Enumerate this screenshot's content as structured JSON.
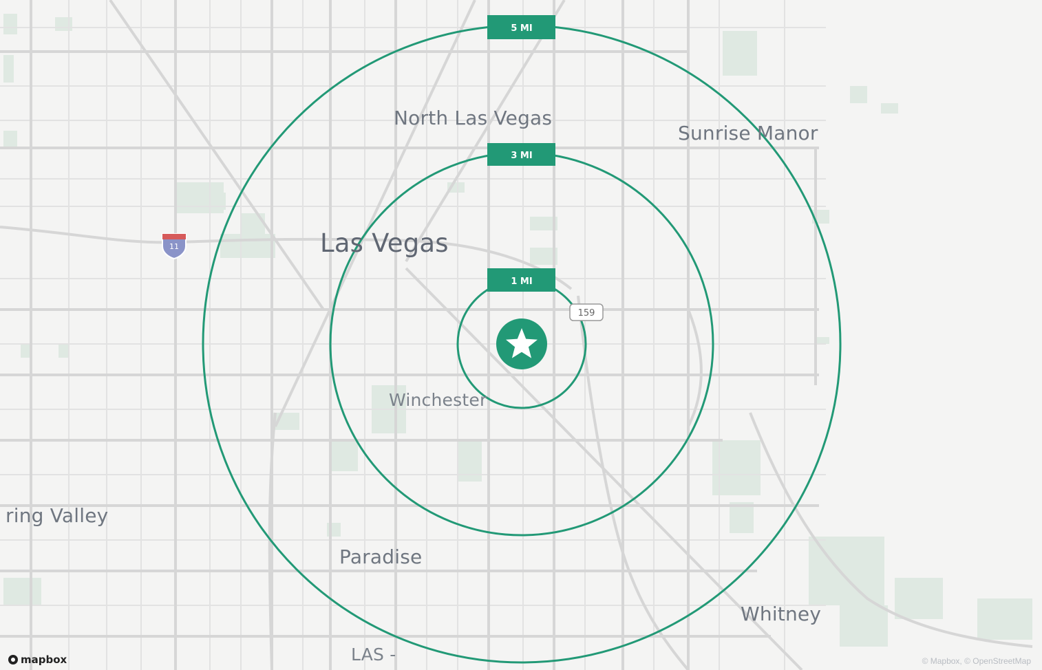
{
  "map": {
    "places": [
      {
        "id": "north-las-vegas",
        "label": "North Las Vegas"
      },
      {
        "id": "sunrise-manor",
        "label": "Sunrise Manor"
      },
      {
        "id": "las-vegas",
        "label": "Las Vegas"
      },
      {
        "id": "winchester",
        "label": "Winchester"
      },
      {
        "id": "spring-valley",
        "label": "ring Valley"
      },
      {
        "id": "paradise",
        "label": "Paradise"
      },
      {
        "id": "whitney",
        "label": "Whitney"
      },
      {
        "id": "las-airport",
        "label": "LAS -"
      }
    ],
    "radius_rings": [
      {
        "label": "5 MI",
        "miles": 5
      },
      {
        "label": "3 MI",
        "miles": 3
      },
      {
        "label": "1 MI",
        "miles": 1
      }
    ],
    "shields": {
      "interstate": "11",
      "state_route": "159"
    },
    "center_marker": "star-icon",
    "attribution": {
      "logo": "mapbox",
      "text": "© Mapbox, © OpenStreetMap"
    },
    "colors": {
      "ring": "#229976",
      "label_bg": "#229976",
      "road": "#d7d7d7",
      "park": "#dfe9e2",
      "background": "#f4f4f3"
    }
  }
}
